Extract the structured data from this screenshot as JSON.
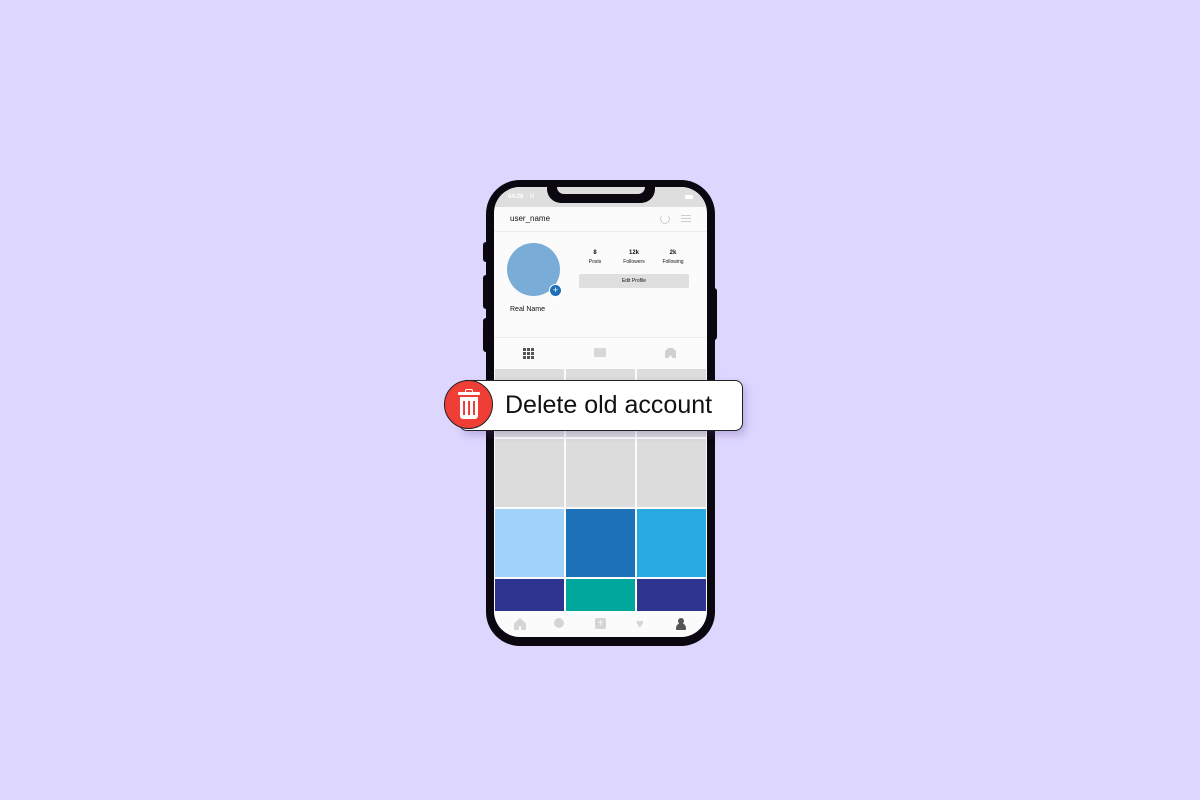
{
  "status_bar": {
    "time": "04:28",
    "signal": "lll"
  },
  "header": {
    "username": "user_name"
  },
  "profile": {
    "real_name": "Real Name",
    "stats": [
      {
        "value": "8",
        "label": "Posts"
      },
      {
        "value": "12k",
        "label": "Followers"
      },
      {
        "value": "2k",
        "label": "Following"
      }
    ],
    "edit_profile_label": "Edit Profile",
    "add_badge": "+"
  },
  "grid_colors": [
    "#dcdcdc",
    "#dcdcdc",
    "#dcdcdc",
    "#dcdcdc",
    "#dcdcdc",
    "#dcdcdc",
    "#a1d2f9",
    "#1d71b8",
    "#29a9e1",
    "#2e3591",
    "#00a79d",
    "#2e3591",
    "#2fb673",
    "#1d71b8",
    "#00a79d"
  ],
  "bottom_nav": {
    "add": "+",
    "heart": "♥"
  },
  "overlay": {
    "label": "Delete old account"
  },
  "colors": {
    "background": "#ddd6fe",
    "accent_red": "#ef3e35",
    "avatar": "#79acd7"
  }
}
